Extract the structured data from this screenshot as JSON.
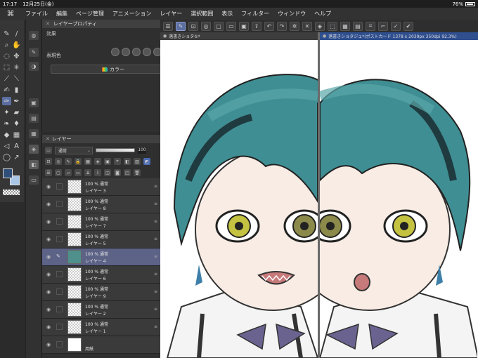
{
  "status": {
    "time": "17:17",
    "date": "12月25日(金)",
    "battery": "76%"
  },
  "menu": [
    "ファイル",
    "編集",
    "ページ管理",
    "アニメーション",
    "レイヤー",
    "選択範囲",
    "表示",
    "フィルター",
    "ウィンドウ",
    "ヘルプ"
  ],
  "property_panel": {
    "title": "レイヤープロパティ",
    "effect_label": "効果",
    "expression_label": "表現色",
    "expression_value": "カラー"
  },
  "layer_panel": {
    "title": "レイヤー",
    "blend_mode": "通常",
    "opacity": "100",
    "layers": [
      {
        "line1": "100 % 通常",
        "line2": "レイヤー 3",
        "selected": false
      },
      {
        "line1": "100 % 通常",
        "line2": "レイヤー 8",
        "selected": false
      },
      {
        "line1": "100 % 通常",
        "line2": "レイヤー 7",
        "selected": false
      },
      {
        "line1": "100 % 通常",
        "line2": "レイヤー 5",
        "selected": false
      },
      {
        "line1": "100 % 通常",
        "line2": "レイヤー 4",
        "selected": true
      },
      {
        "line1": "100 % 通常",
        "line2": "レイヤー 6",
        "selected": false
      },
      {
        "line1": "100 % 通常",
        "line2": "レイヤー 9",
        "selected": false
      },
      {
        "line1": "100 % 通常",
        "line2": "レイヤー 2",
        "selected": false
      },
      {
        "line1": "100 % 通常",
        "line2": "レイヤー 1",
        "selected": false
      },
      {
        "line1": "",
        "line2": "用紙",
        "selected": false
      }
    ]
  },
  "canvas": {
    "tab_left": "落書きショタ①*",
    "tab_right": "落書きショタジェ*(ポストカード 1378 x 2039px 350dpi 92.3%)"
  },
  "colors": {
    "main_color": "#2f4e78",
    "sub_color": "#a9c6e6",
    "selected_layer": "#5d6387",
    "active_tab": "#2f4f8f"
  },
  "icons": {
    "menu_logo": "clip-studio-logo-icon",
    "eye": "eye-icon"
  }
}
